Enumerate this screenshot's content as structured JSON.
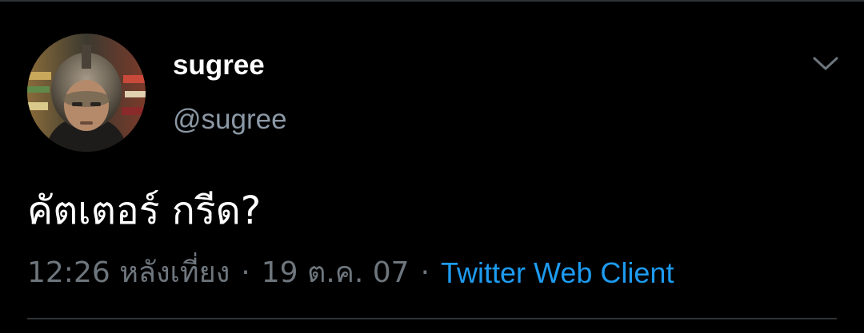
{
  "author": {
    "display_name": "sugree",
    "handle": "@sugree",
    "avatar_icon": "profile-photo"
  },
  "tweet": {
    "text": "คัตเตอร์ กรีด?",
    "time": "12:26 หลังเที่ยง",
    "date": "19 ต.ค. 07",
    "separator": "·",
    "source": "Twitter Web Client"
  },
  "menu": {
    "icon": "chevron-down-icon"
  },
  "colors": {
    "background": "#000000",
    "primary_text": "#ffffff",
    "secondary_text": "#6e767d",
    "link": "#1d9bf0",
    "divider": "#2f3336"
  }
}
